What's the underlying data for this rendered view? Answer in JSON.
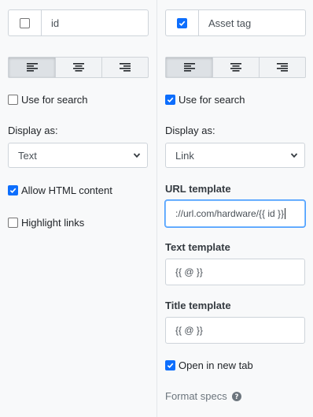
{
  "left": {
    "name_checked": false,
    "name_value": "id",
    "alignment_active": "left",
    "use_for_search": {
      "label": "Use for search",
      "checked": false
    },
    "display_as": {
      "label": "Display as:",
      "value": "Text"
    },
    "allow_html": {
      "label": "Allow HTML content",
      "checked": true
    },
    "highlight_links": {
      "label": "Highlight links",
      "checked": false
    }
  },
  "right": {
    "name_checked": true,
    "name_value": "Asset tag",
    "alignment_active": "left",
    "use_for_search": {
      "label": "Use for search",
      "checked": true
    },
    "display_as": {
      "label": "Display as:",
      "value": "Link"
    },
    "url_template": {
      "label": "URL template",
      "value": "://url.com/hardware/{{ id }}"
    },
    "text_template": {
      "label": "Text template",
      "value": "{{ @ }}"
    },
    "title_template": {
      "label": "Title template",
      "value": "{{ @ }}"
    },
    "open_new_tab": {
      "label": "Open in new tab",
      "checked": true
    },
    "format_specs": {
      "label": "Format specs"
    }
  },
  "icons": {
    "align": [
      "align-left-icon",
      "align-center-icon",
      "align-right-icon"
    ],
    "select": "chevron-down-icon",
    "help": "question-circle-icon",
    "check": "checkmark-icon"
  },
  "colors": {
    "accent": "#0d6efd",
    "panel": "#f8f9fa",
    "border": "#ced4da"
  }
}
